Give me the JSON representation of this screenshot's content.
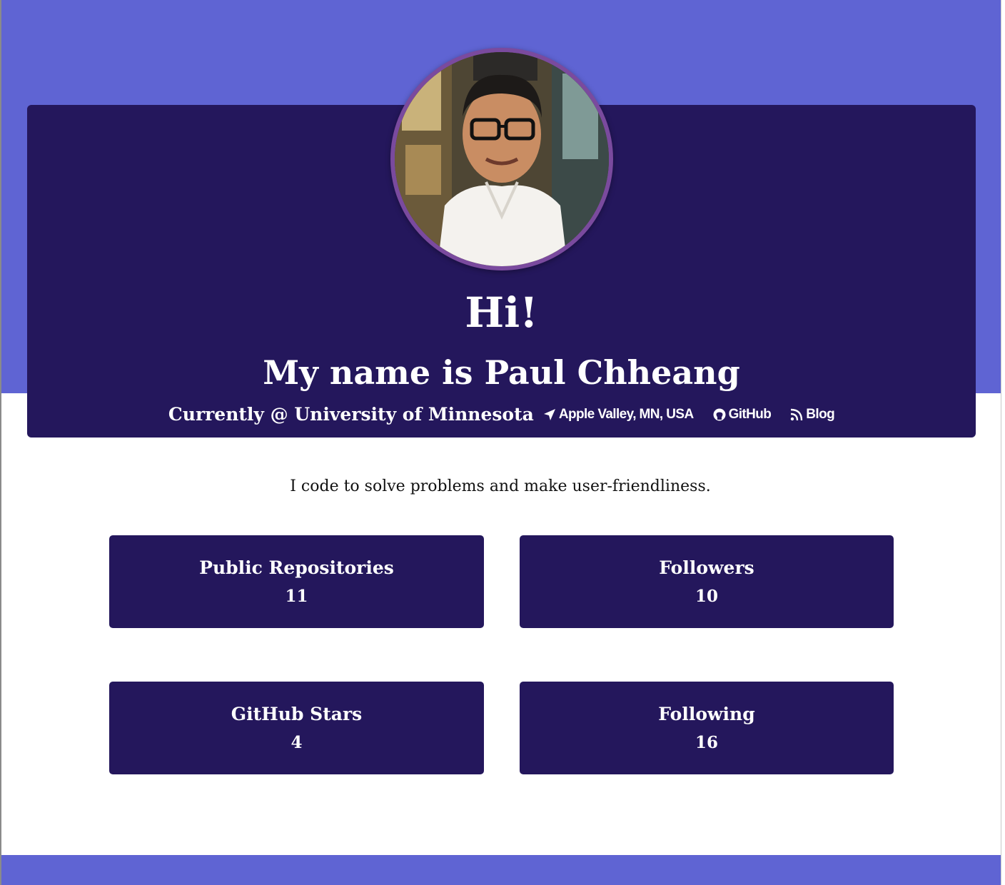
{
  "header": {
    "greeting": "Hi!",
    "name_line": "My name is Paul Chheang",
    "current": "Currently @ University of Minnesota",
    "location": "Apple Valley, MN, USA",
    "github_label": "GitHub",
    "blog_label": "Blog"
  },
  "tagline": "I code to solve problems and make user-friendliness.",
  "stats": {
    "public_repos": {
      "label": "Public Repositories",
      "value": "11"
    },
    "followers": {
      "label": "Followers",
      "value": "10"
    },
    "stars": {
      "label": "GitHub Stars",
      "value": "4"
    },
    "following": {
      "label": "Following",
      "value": "16"
    }
  },
  "colors": {
    "band": "#5f64d3",
    "card": "#24175c",
    "avatar_ring": "#7a4a9e"
  },
  "icons": {
    "location": "location-arrow-icon",
    "github": "github-icon",
    "blog": "rss-icon"
  }
}
